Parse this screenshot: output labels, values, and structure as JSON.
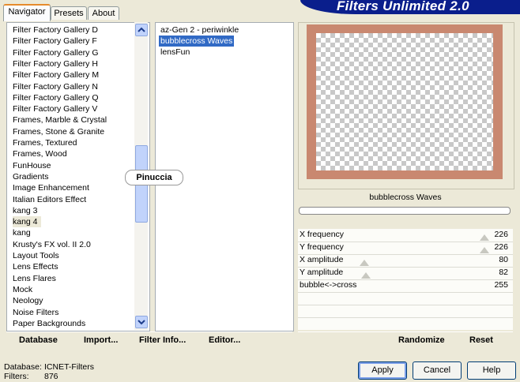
{
  "banner": {
    "title": "Filters Unlimited 2.0"
  },
  "tabs": [
    {
      "label": "Navigator",
      "active": true
    },
    {
      "label": "Presets",
      "active": false
    },
    {
      "label": "About",
      "active": false
    }
  ],
  "categories": [
    "Filter Factory Gallery D",
    "Filter Factory Gallery F",
    "Filter Factory Gallery G",
    "Filter Factory Gallery H",
    "Filter Factory Gallery M",
    "Filter Factory Gallery N",
    "Filter Factory Gallery Q",
    "Filter Factory Gallery V",
    "Frames, Marble & Crystal",
    "Frames, Stone & Granite",
    "Frames, Textured",
    "Frames, Wood",
    "FunHouse",
    "Gradients",
    "Image Enhancement",
    "Italian Editors Effect",
    "kang 3",
    "kang 4",
    "kang",
    "Krusty's FX vol. II 2.0",
    "Layout Tools",
    "Lens Effects",
    "Lens Flares",
    "Mock",
    "Neology",
    "Noise Filters",
    "Paper Backgrounds"
  ],
  "selected_category": "kang 4",
  "watermark": "Pinuccia",
  "filters": [
    "az-Gen 2  -  periwinkle",
    "bubblecross Waves",
    "lensFun"
  ],
  "selected_filter": "bubblecross Waves",
  "preview": {
    "filter_name": "bubblecross Waves"
  },
  "params": [
    {
      "label": "X frequency",
      "value": "226"
    },
    {
      "label": "Y frequency",
      "value": "226"
    },
    {
      "label": "X amplitude",
      "value": "80"
    },
    {
      "label": "Y amplitude",
      "value": "82"
    },
    {
      "label": "bubble<->cross",
      "value": "255"
    }
  ],
  "toolbar": {
    "database": "Database",
    "import": "Import...",
    "filter_info": "Filter Info...",
    "editor": "Editor...",
    "randomize": "Randomize",
    "reset": "Reset"
  },
  "status": {
    "database_label": "Database:",
    "database_value": "ICNET-Filters",
    "filters_label": "Filters:",
    "filters_value": "876"
  },
  "buttons": {
    "apply": "Apply",
    "cancel": "Cancel",
    "help": "Help"
  },
  "colors": {
    "selection": "#316ac5",
    "banner": "#0a1e8c",
    "frame": "#c98870"
  }
}
